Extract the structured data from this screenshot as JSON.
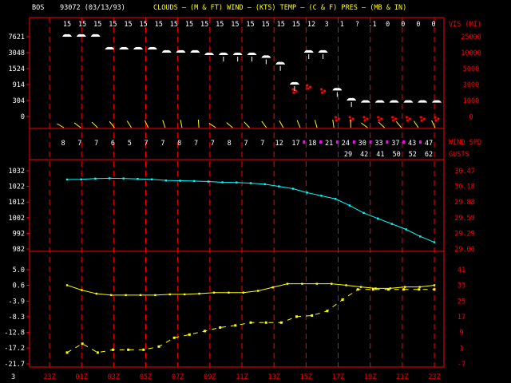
{
  "header": {
    "station": "BOS",
    "id_date": "93072  (03/13/93)",
    "title": "CLOUDS – (M & FT) WIND – (KTS) TEMP – (C & F) PRES – (MB & IN)"
  },
  "labels": {
    "vis_label": "VIS (MI)",
    "wind_label": "WIND SPD",
    "gust_label": "GUSTS",
    "corner": "3"
  },
  "colors": {
    "frame": "#ff0000",
    "text": "#ffffff",
    "header": "#ffff00",
    "pressure": "#00ffff",
    "temperature": "#ffff00",
    "gust_marker": "#ff00ff",
    "precip": "#ff0000"
  },
  "chart_data": {
    "type": "line",
    "x_ticks": [
      "23Z",
      "01Z",
      "03Z",
      "05Z",
      "07Z",
      "09Z",
      "11Z",
      "13Z",
      "15Z",
      "17Z",
      "19Z",
      "21Z",
      "23Z"
    ],
    "visibility": [
      "15",
      "15",
      "15",
      "15",
      "15",
      "15",
      "15",
      "15",
      "15",
      "15",
      "15",
      "15",
      "15",
      "15",
      "15",
      "15",
      "12",
      "3",
      "1",
      "?",
      ".1",
      "0",
      "0",
      "0",
      "0"
    ],
    "clouds": {
      "left_axis_ticks": [
        "7621",
        "3048",
        "1524",
        "914",
        "304",
        "0"
      ],
      "right_axis_ticks": [
        "25000",
        "10000",
        "5000",
        "3000",
        "1000",
        "0"
      ],
      "ceiling_ft": [
        25000,
        25000,
        25000,
        12000,
        12000,
        12000,
        12000,
        10000,
        10000,
        10000,
        9000,
        9000,
        9000,
        9000,
        8000,
        6000,
        3000,
        10000,
        10000,
        2000,
        1000,
        400,
        400,
        400,
        400,
        400,
        400
      ]
    },
    "wind": {
      "speed": [
        "8",
        "7",
        "7",
        "6",
        "5",
        "7",
        "7",
        "8",
        "7",
        "7",
        "8",
        "7",
        "7",
        "12",
        "17",
        "18",
        "21",
        "24",
        "30",
        "33",
        "37",
        "43",
        "47"
      ],
      "gusts": [
        "29",
        "42",
        "41",
        "50",
        "52",
        "62"
      ]
    },
    "pressure": {
      "mb_ticks": [
        "1032",
        "1022",
        "1012",
        "1002",
        "992",
        "982"
      ],
      "in_ticks": [
        "30.47",
        "30.18",
        "29.88",
        "29.59",
        "29.29",
        "29.00"
      ],
      "ylim": [
        982,
        1032
      ],
      "values_mb": [
        1026.4,
        1026.5,
        1027.0,
        1027.2,
        1027.1,
        1026.8,
        1026.5,
        1025.8,
        1025.6,
        1025.4,
        1025.1,
        1024.6,
        1024.5,
        1024.1,
        1023.4,
        1022.0,
        1020.5,
        1018.0,
        1016.0,
        1014.0,
        1009.8,
        1005.0,
        1001.5,
        998.0,
        994.5,
        990.0,
        986.3
      ]
    },
    "temperature": {
      "c_ticks": [
        "5.0",
        "0.6",
        "-3.9",
        "-8.3",
        "-12.8",
        "-17.2",
        "-21.7"
      ],
      "f_ticks": [
        "41",
        "33",
        "25",
        "17",
        "9",
        "1",
        "-7"
      ],
      "ylim_c": [
        -21.7,
        5.0
      ],
      "temp_c": [
        0.6,
        -0.8,
        -1.8,
        -2.2,
        -2.2,
        -2.2,
        -2.2,
        -2.0,
        -2.0,
        -1.8,
        -1.5,
        -1.5,
        -1.5,
        -1.0,
        0.0,
        1.0,
        1.0,
        1.0,
        1.0,
        0.6,
        0.1,
        -0.3,
        -0.3,
        0.1,
        0.1,
        0.6
      ],
      "dewpoint_c": [
        -18.5,
        -16.0,
        -18.5,
        -17.7,
        -17.7,
        -17.7,
        -16.8,
        -14.3,
        -13.4,
        -12.4,
        -11.4,
        -10.8,
        -10.0,
        -10.0,
        -10.0,
        -8.3,
        -8.0,
        -6.7,
        -3.5,
        -0.6,
        -0.6,
        -0.6,
        -0.6,
        -0.6,
        -0.6
      ]
    }
  }
}
